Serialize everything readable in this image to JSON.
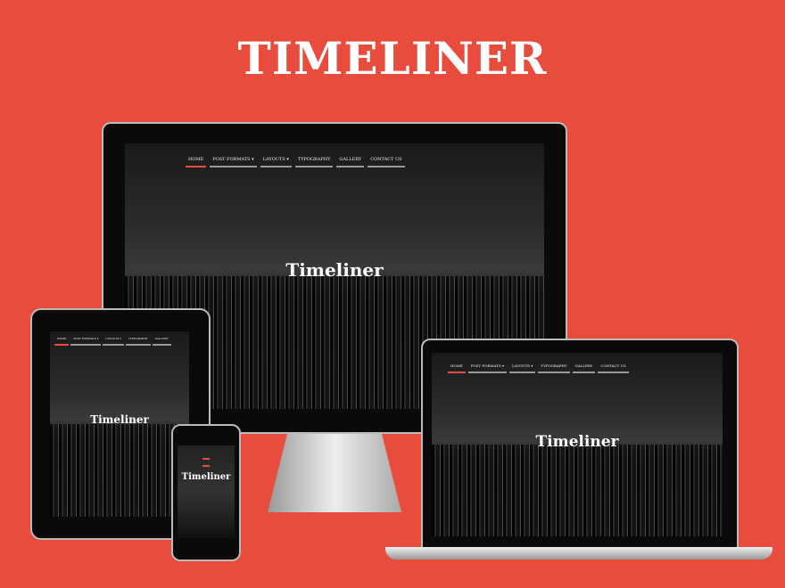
{
  "title": "TIMELINER",
  "site_title": "Timeliner",
  "nav": [
    "HOME",
    "POST FORMATS ▾",
    "LAYOUTS ▾",
    "TYPOGRAPHY",
    "GALLERY",
    "CONTACT US"
  ],
  "accent": "#e74c3c"
}
